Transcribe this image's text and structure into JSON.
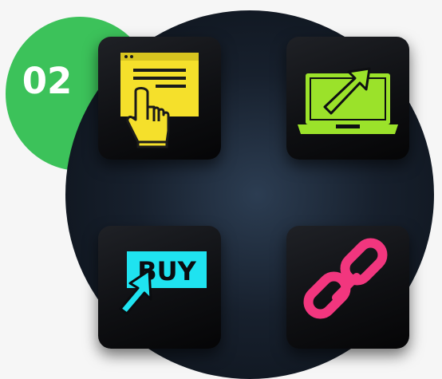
{
  "badge": {
    "label": "02",
    "color": "#3cc25a"
  },
  "tiles": [
    {
      "name": "website-click",
      "icon": "browser-pointer-hand-icon",
      "color": "#f5e02b"
    },
    {
      "name": "laptop-growth",
      "icon": "laptop-arrow-icon",
      "color": "#9be22a"
    },
    {
      "name": "buy-button",
      "icon": "buy-cursor-icon",
      "color": "#1fe3f0",
      "label": "BUY"
    },
    {
      "name": "chain-link",
      "icon": "link-chain-icon",
      "color": "#f2367e"
    }
  ],
  "background": {
    "page": "#f6f6f6",
    "circle": "#17202d"
  }
}
